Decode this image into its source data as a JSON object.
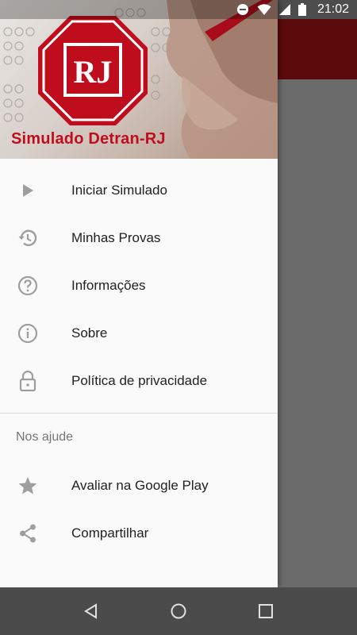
{
  "status_bar": {
    "time": "21:02",
    "icons": [
      "do-not-disturb-icon",
      "wifi-icon",
      "signal-icon",
      "battery-icon"
    ]
  },
  "drawer": {
    "header": {
      "badge_text": "RJ",
      "title": "Simulado Detran-RJ",
      "accent_color": "#c00d1e"
    },
    "items": [
      {
        "label": "Iniciar Simulado",
        "icon": "play-icon"
      },
      {
        "label": "Minhas Provas",
        "icon": "history-icon"
      },
      {
        "label": "Informações",
        "icon": "help-icon"
      },
      {
        "label": "Sobre",
        "icon": "info-icon"
      },
      {
        "label": "Política de privacidade",
        "icon": "lock-icon"
      }
    ],
    "section_title": "Nos ajude",
    "section_items": [
      {
        "label": "Avaliar na Google Play",
        "icon": "star-icon"
      },
      {
        "label": "Compartilhar",
        "icon": "share-icon"
      }
    ]
  },
  "nav_bar": {
    "buttons": [
      "back-icon",
      "home-icon",
      "recents-icon"
    ]
  },
  "colors": {
    "app_toolbar": "#5a0a0a",
    "drawer_bg": "#fafafa",
    "icon_gray": "#9e9e9e"
  }
}
